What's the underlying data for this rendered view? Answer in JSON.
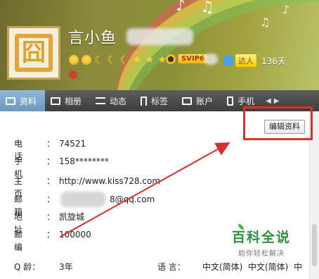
{
  "profile": {
    "nickname": "言小鱼",
    "vip_label": "SVIP6",
    "daren_label": "达人",
    "days": "136天",
    "avatar_glyph": "囧"
  },
  "tabs": [
    {
      "label": "资料",
      "icon": "profile-card-icon",
      "active": true
    },
    {
      "label": "相册",
      "icon": "photo-album-icon",
      "active": false
    },
    {
      "label": "动态",
      "icon": "feed-list-icon",
      "active": false
    },
    {
      "label": "标签",
      "icon": "bookmark-tag-icon",
      "active": false
    },
    {
      "label": "账户",
      "icon": "wallet-icon",
      "active": false
    },
    {
      "label": "手机",
      "icon": "phone-icon",
      "active": false
    }
  ],
  "actions": {
    "edit_label": "编辑资料"
  },
  "fields": [
    {
      "label": "电话",
      "value": "74521"
    },
    {
      "label": "手机",
      "value": "158********"
    },
    {
      "label": "主页",
      "value": "http://www.kiss728.com"
    },
    {
      "label": "邮箱",
      "value": "8@qq.com"
    },
    {
      "label": "地址",
      "value": "凯旋城"
    },
    {
      "label": "邮编",
      "value": "100000"
    }
  ],
  "bottom_row": {
    "age_label": "Q  龄：",
    "age_value": "3年",
    "lang_label": "语  言：",
    "lang_values": [
      "中文(简体)",
      "中文(简体)",
      "中"
    ]
  },
  "watermark": {
    "title": "百科全说",
    "subtitle": "助你轻松解决"
  },
  "colors": {
    "highlight": "#e0302a",
    "tab_active": "#7aa6cc",
    "tab_bar": "#4a4a4a"
  }
}
